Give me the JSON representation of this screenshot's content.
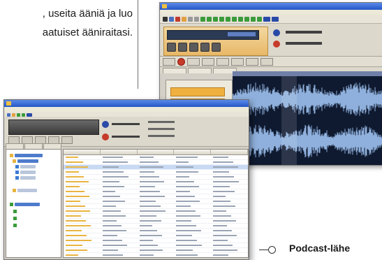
{
  "body_text": {
    "line1": ", useita ääniä ja luo",
    "line2": "aatuiset ääniraitasi."
  },
  "caption": "Podcast-lähe",
  "colors": {
    "waveform": "#8fb0dc",
    "waveform_background": "#0f1a30",
    "selection_highlight": "#ffffff",
    "panel_orange": "#e8b868",
    "window_chrome": "#d4d0c8"
  }
}
